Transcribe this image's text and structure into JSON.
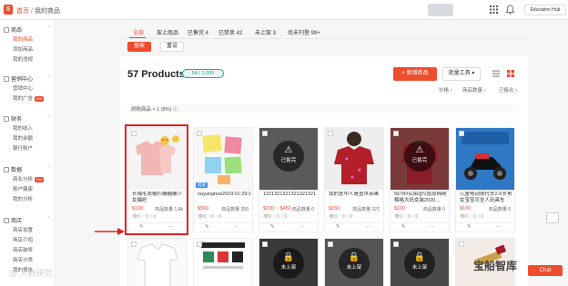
{
  "header": {
    "breadcrumb_home": "首页",
    "breadcrumb_sep": "/",
    "breadcrumb_current": "我的商品",
    "shop_name": "Education Hub"
  },
  "sidebar": {
    "sections": [
      {
        "label": "商品",
        "items": [
          {
            "label": "我的商品",
            "active": true
          },
          {
            "label": "添加商品"
          },
          {
            "label": "我的违规"
          }
        ]
      },
      {
        "label": "营销中心",
        "items": [
          {
            "label": "营销中心"
          },
          {
            "label": "我的广告",
            "hot": "Hot"
          }
        ]
      },
      {
        "label": "财务",
        "items": [
          {
            "label": "我的收入"
          },
          {
            "label": "我的余额"
          },
          {
            "label": "银行账户"
          }
        ]
      },
      {
        "label": "数据",
        "items": [
          {
            "label": "商业分析",
            "hot": "Hot"
          },
          {
            "label": "账户健康"
          },
          {
            "label": "我的分析"
          }
        ]
      },
      {
        "label": "商店",
        "items": [
          {
            "label": "商店设置"
          },
          {
            "label": "商店介绍"
          },
          {
            "label": "商店装修"
          },
          {
            "label": "商店分类"
          },
          {
            "label": "我的报告"
          }
        ]
      }
    ]
  },
  "tabs": [
    {
      "label": "全部",
      "active": true
    },
    {
      "label": "架上商品"
    },
    {
      "label": "已售完 4"
    },
    {
      "label": "已禁卖 42"
    },
    {
      "label": "未上架 3"
    },
    {
      "label": "尚未刊登 99+"
    }
  ],
  "filters": {
    "search_label": "搜索",
    "reset_label": "重设"
  },
  "products_header": {
    "title": "57 Products",
    "count": "54 / 1,000",
    "new_button": "+ 新增商品",
    "bulk_button": "批量工具 ▾"
  },
  "sort_labels": [
    "价格 ↕",
    "商品数量 ↕",
    "已售出 ↕"
  ],
  "selection_text": "拼购商品 × 1 (8%) ⓘ",
  "products": [
    {
      "title": "长袖毛衣帽衫腰糖腰少女编织",
      "price": "$100",
      "sold": "商品数量 1.4k",
      "stats": "👁0  ♡0  ☆0",
      "image": "sweater"
    },
    {
      "title": "ouyangtest2019:01:29:13:03:03",
      "price": "$500",
      "sold": "商品数量 200",
      "stats": "👁0  ♡0  ☆0",
      "image": "notes",
      "badge": "批发"
    },
    {
      "title": "1321321321321321321313213",
      "price": "$200 ~ $450",
      "sold": "商品数量 0",
      "stats": "👁0  ♡0  ☆0",
      "image": "sold_out",
      "overlay": "已售完"
    },
    {
      "title": "我的意中人是盖世英雄",
      "price": "$150",
      "sold": "商品数量 321",
      "stats": "👁0  ♡0  ☆0",
      "image": "red_top"
    },
    {
      "title": "5678#实拍@V宽原棉纯棉格大码女装2020…",
      "price": "$100",
      "sold": "商品数量 0",
      "stats": "👁0  ♡0  ☆0",
      "image": "sold_out_floral",
      "overlay": "已售完"
    },
    {
      "title": "儿童电动摩托车2-6岁男女宝宝可坐人玩具车",
      "price": "$100",
      "sold": "商品数量 0",
      "stats": "👁0  ♡0  ☆0",
      "image": "motorbike"
    }
  ],
  "products_row2": [
    {
      "image": "polo"
    },
    {
      "image": "flyer"
    },
    {
      "image": "unlisted_dark",
      "overlay": "未上架"
    },
    {
      "image": "unlisted_shirt",
      "overlay": "未上架"
    },
    {
      "image": "unlisted_lipstick",
      "overlay": "未上架"
    },
    {
      "image": "lipstick"
    }
  ],
  "card_actions": [
    "✎",
    "⋯"
  ],
  "float": {
    "chat_label": "Chat"
  },
  "watermarks": {
    "left": "@ 大数研究",
    "right": "宝船智库"
  },
  "colors": {
    "brand": "#ee4d2d",
    "teal": "#26aa99",
    "highlight": "#e02020"
  }
}
